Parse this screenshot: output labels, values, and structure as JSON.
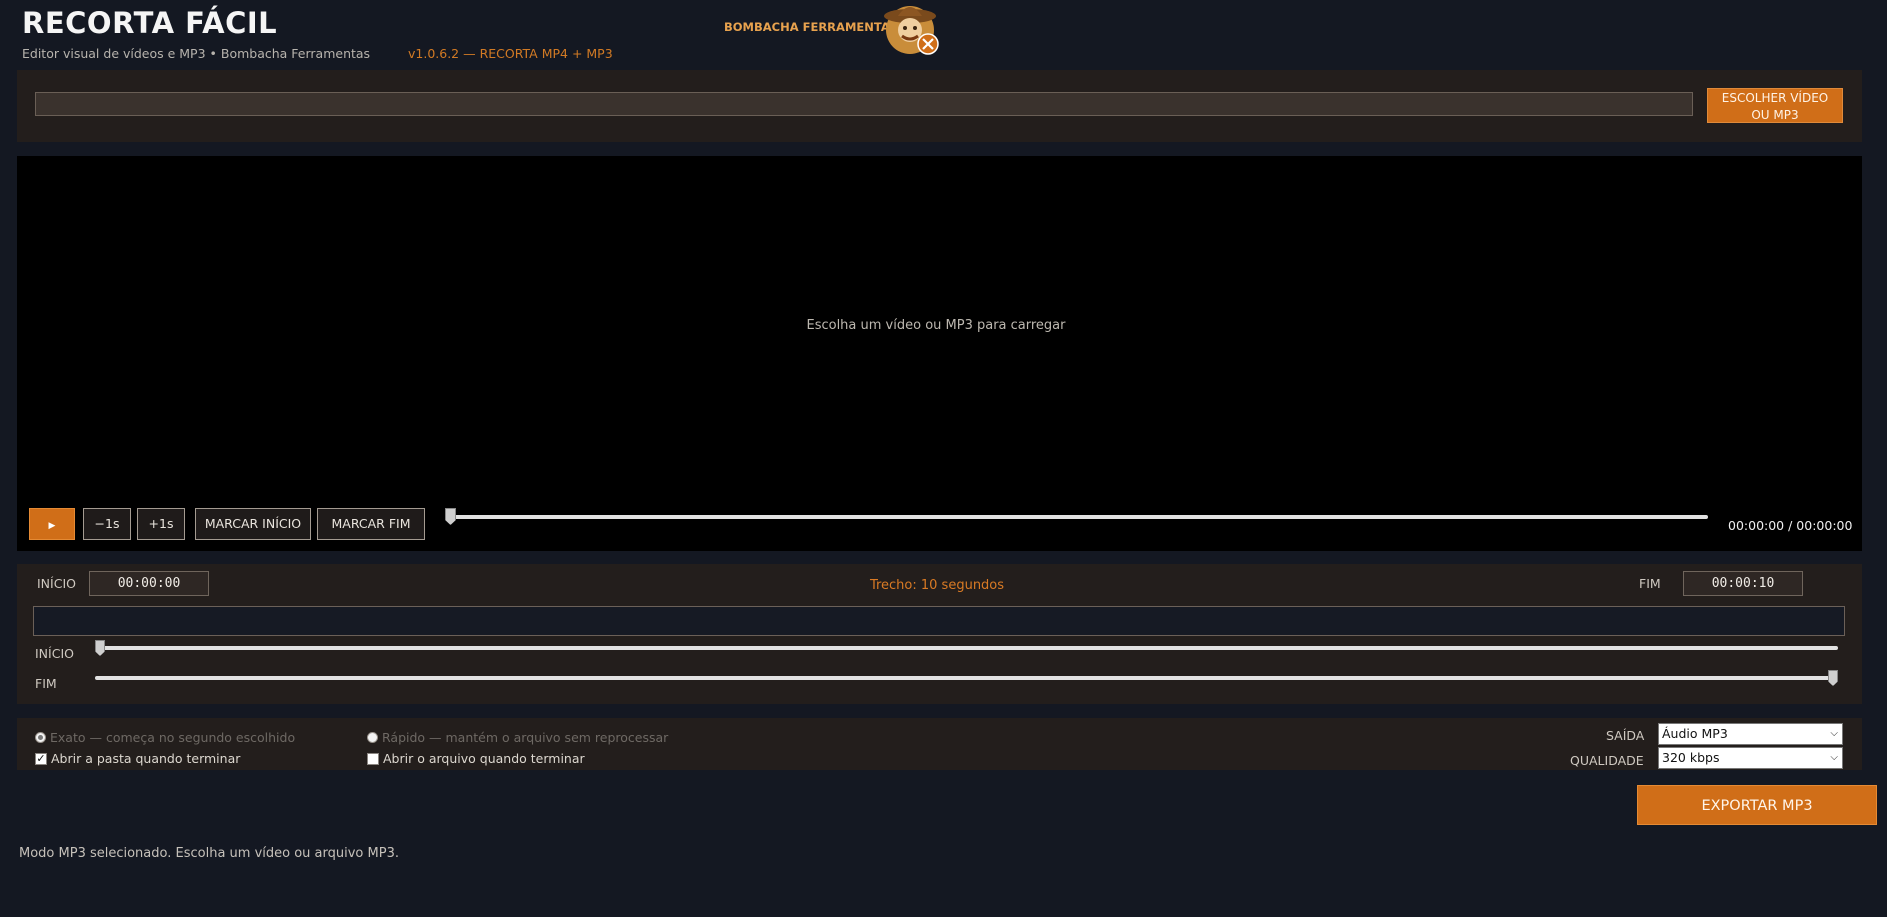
{
  "header": {
    "title": "RECORTA FÁCIL",
    "subtitle": "Editor visual de vídeos e MP3 • Bombacha Ferramentas",
    "version": "v1.0.6.2 — RECORTA MP4 + MP3",
    "brand": "BOMBACHA FERRAMENTAS"
  },
  "file": {
    "path_value": "",
    "choose_line1": "ESCOLHER VÍDEO",
    "choose_line2": "OU MP3"
  },
  "video": {
    "placeholder": "Escolha um vídeo ou MP3 para carregar",
    "play_label": "▶",
    "back_label": "−1s",
    "forward_label": "+1s",
    "mark_start_label": "MARCAR INÍCIO",
    "mark_end_label": "MARCAR FIM",
    "time": "00:00:00 / 00:00:00",
    "seek_position": 0
  },
  "trim": {
    "start_label": "INÍCIO",
    "start_value": "00:00:00",
    "duration_text": "Trecho: 10 segundos",
    "end_label": "FIM",
    "end_value": "00:00:10",
    "slider_start_label": "INÍCIO",
    "slider_end_label": "FIM",
    "slider_start_position": 0,
    "slider_end_position": 1
  },
  "options": {
    "exact_label": "Exato — começa no segundo escolhido",
    "fast_label": "Rápido — mantém o arquivo sem reprocessar",
    "open_folder_label": "Abrir a pasta quando terminar",
    "open_file_label": "Abrir o arquivo quando terminar",
    "output_label": "SAÍDA",
    "output_value": "Áudio MP3",
    "quality_label": "QUALIDADE",
    "quality_value": "320 kbps"
  },
  "export_label": "EXPORTAR MP3",
  "status": "Modo MP3 selecionado. Escolha um vídeo ou arquivo MP3.",
  "colors": {
    "accent": "#d06e18",
    "background": "#141822",
    "panel": "#231e1c"
  }
}
